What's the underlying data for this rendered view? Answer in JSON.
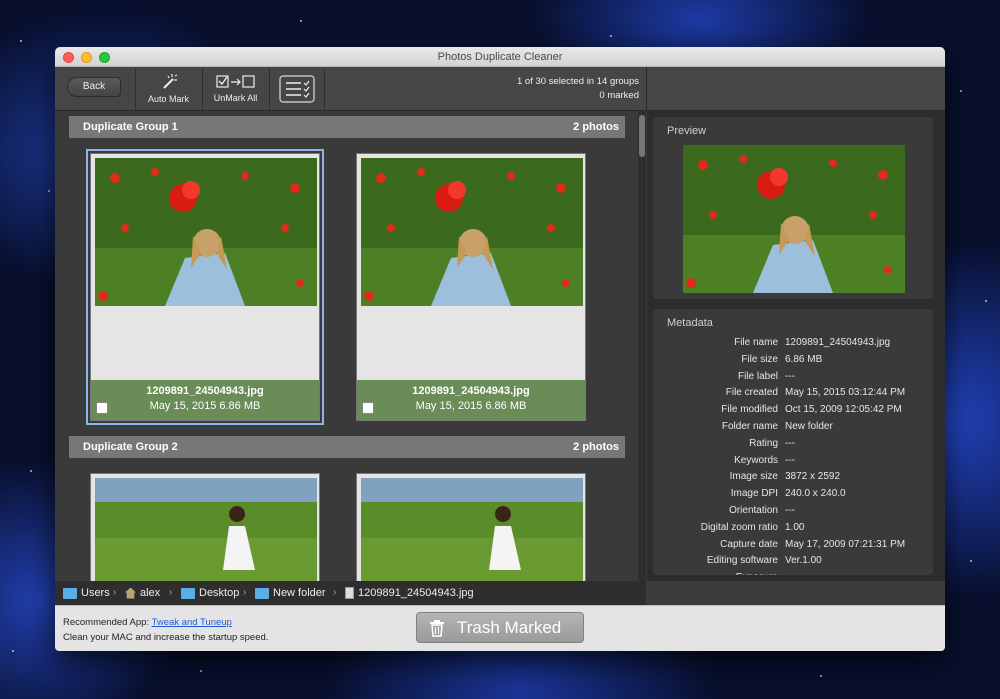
{
  "window": {
    "title": "Photos Duplicate Cleaner"
  },
  "toolbar": {
    "back_label": "Back",
    "auto_mark_label": "Auto Mark",
    "unmark_all_label": "UnMark All",
    "selection_info": "1 of 30 selected in 14 groups",
    "marked_info": "0 marked"
  },
  "groups": [
    {
      "title": "Duplicate Group 1",
      "count": "2 photos",
      "photos": [
        {
          "filename": "1209891_24504943.jpg",
          "info": "May 15, 2015  6.86 MB"
        },
        {
          "filename": "1209891_24504943.jpg",
          "info": "May 15, 2015  6.86 MB"
        }
      ]
    },
    {
      "title": "Duplicate Group 2",
      "count": "2 photos"
    }
  ],
  "preview": {
    "title": "Preview"
  },
  "metadata": {
    "title": "Metadata",
    "rows": [
      {
        "key": "File name",
        "value": "1209891_24504943.jpg"
      },
      {
        "key": "File size",
        "value": "6.86 MB"
      },
      {
        "key": "File label",
        "value": "---"
      },
      {
        "key": "File created",
        "value": "May 15, 2015 03:12:44 PM"
      },
      {
        "key": "File modified",
        "value": "Oct 15, 2009 12:05:42 PM"
      },
      {
        "key": "Folder name",
        "value": "New folder"
      },
      {
        "key": "Rating",
        "value": "---"
      },
      {
        "key": "Keywords",
        "value": "---"
      },
      {
        "key": "Image size",
        "value": "3872 x 2592"
      },
      {
        "key": "Image DPI",
        "value": "240.0 x 240.0"
      },
      {
        "key": "Orientation",
        "value": "---"
      },
      {
        "key": "Digital zoom ratio",
        "value": "1.00"
      },
      {
        "key": "Capture date",
        "value": "May 17, 2009 07:21:31 PM"
      },
      {
        "key": "Editing software",
        "value": "Ver.1.00"
      },
      {
        "key": "Exposure",
        "value": "---"
      }
    ]
  },
  "path": [
    "Users",
    "alex",
    "Desktop",
    "New folder",
    "1209891_24504943.jpg"
  ],
  "footer": {
    "recommended_label": "Recommended App:",
    "recommended_link": "Tweak and Tuneup",
    "recommended_text": "Clean your MAC and increase the startup speed.",
    "trash_label": "Trash Marked"
  },
  "colors": {
    "accent_green": "#6a8c57",
    "link": "#1f5bd8",
    "selection_outline": "#8ab4ea"
  }
}
